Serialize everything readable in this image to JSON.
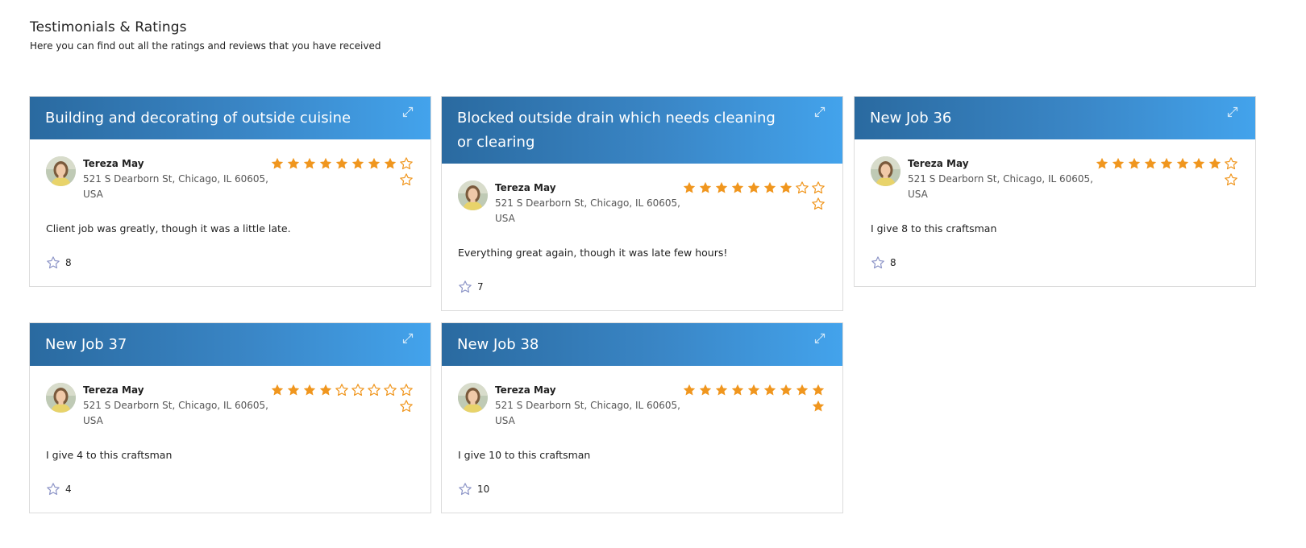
{
  "page": {
    "title": "Testimonials & Ratings",
    "subtitle": "Here you can find out all the ratings and reviews that you have received"
  },
  "colors": {
    "header_gradient_start": "#2a6aa0",
    "header_gradient_end": "#43a3ec",
    "star": "#f0961e",
    "rating_icon": "#8e96c8"
  },
  "icons": {
    "expand": "expand-arrows-icon",
    "star_filled": "star-filled-icon",
    "star_empty": "star-outline-icon",
    "rating": "star-outline-icon"
  },
  "cards": [
    {
      "title": "Building and decorating of outside cuisine",
      "reviewer": {
        "name": "Tereza May",
        "address": "521 S Dearborn St, Chicago, IL 60605, USA"
      },
      "rating": 8,
      "max_rating": 10,
      "comment": "Client job was greatly, though it was a little late.",
      "rating_count": "8"
    },
    {
      "title": "Blocked outside drain which needs cleaning or clearing",
      "reviewer": {
        "name": "Tereza May",
        "address": "521 S Dearborn St, Chicago, IL 60605, USA"
      },
      "rating": 7,
      "max_rating": 10,
      "comment": "Everything great again, though it was late few hours!",
      "rating_count": "7"
    },
    {
      "title": "New Job 36",
      "reviewer": {
        "name": "Tereza May",
        "address": "521 S Dearborn St, Chicago, IL 60605, USA"
      },
      "rating": 8,
      "max_rating": 10,
      "comment": "I give 8 to this craftsman",
      "rating_count": "8"
    },
    {
      "title": "New Job 37",
      "reviewer": {
        "name": "Tereza May",
        "address": "521 S Dearborn St, Chicago, IL 60605, USA"
      },
      "rating": 4,
      "max_rating": 10,
      "comment": "I give 4 to this craftsman",
      "rating_count": "4"
    },
    {
      "title": "New Job 38",
      "reviewer": {
        "name": "Tereza May",
        "address": "521 S Dearborn St, Chicago, IL 60605, USA"
      },
      "rating": 10,
      "max_rating": 10,
      "comment": "I give 10 to this craftsman",
      "rating_count": "10"
    }
  ]
}
